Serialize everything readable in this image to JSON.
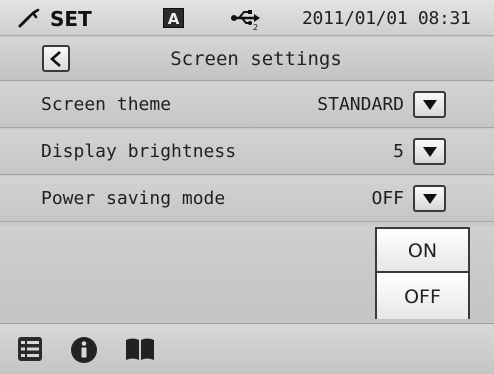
{
  "status_bar": {
    "mode_label": "SET",
    "mode_icon": "wrench-icon",
    "auto_badge": "A",
    "usb_icon": "usb-icon",
    "datetime": "2011/01/01 08:31"
  },
  "header": {
    "back_icon": "chevron-left-icon",
    "title": "Screen settings"
  },
  "settings": [
    {
      "label": "Screen theme",
      "value": "STANDARD"
    },
    {
      "label": "Display brightness",
      "value": "5"
    },
    {
      "label": "Power saving mode",
      "value": "OFF"
    }
  ],
  "popup": {
    "options": [
      "ON",
      "OFF"
    ]
  },
  "bottom_bar": {
    "icons": [
      "list-icon",
      "info-icon",
      "book-icon"
    ]
  },
  "colors": {
    "background": "#c9c9c9",
    "border": "#3a3a3a",
    "text": "#1f1f1f"
  }
}
